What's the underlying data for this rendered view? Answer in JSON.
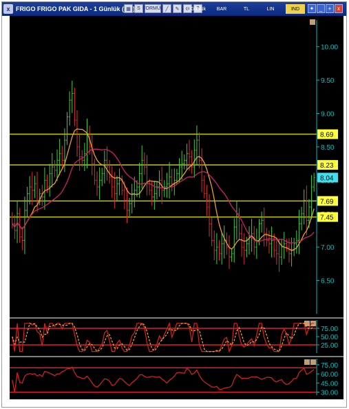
{
  "window": {
    "title": "FRIGO FRIGO PAK GIDA - 1 Günlük (.1d)",
    "close_glyph": "x",
    "toolbar": {
      "period_label": "1 Günlük",
      "chart_type_label": "BAR",
      "currency_label": "TL",
      "scale_label": "LIN",
      "indicator_label": "IND",
      "formula_label": "FORMÜL"
    },
    "controls": [
      "_",
      "+",
      "x"
    ]
  },
  "chart_data": {
    "type": "candlestick",
    "price_axis_ticks": [
      "10.00",
      "9.50",
      "9.00",
      "8.50",
      "8.00",
      "7.50",
      "7.00",
      "6.50"
    ],
    "ylim": [
      6.0,
      10.4
    ],
    "horizontal_levels": [
      {
        "value": 8.69,
        "label": "8.69"
      },
      {
        "value": 8.23,
        "label": "8.23"
      },
      {
        "value": 7.69,
        "label": "7.69"
      },
      {
        "value": 7.45,
        "label": "7.45"
      }
    ],
    "last_price": {
      "value": 8.04,
      "label": "8.04"
    },
    "close_series": [
      7.35,
      7.25,
      7.5,
      7.15,
      7.1,
      7.55,
      7.8,
      7.9,
      7.85,
      7.95,
      7.7,
      7.8,
      7.75,
      8.0,
      7.9,
      8.1,
      8.2,
      8.15,
      8.3,
      8.4,
      8.3,
      8.6,
      8.95,
      9.2,
      9.3,
      8.9,
      8.5,
      8.35,
      8.3,
      8.4,
      8.7,
      8.5,
      8.25,
      8.0,
      7.9,
      8.0,
      8.1,
      8.3,
      8.2,
      8.05,
      7.9,
      7.8,
      7.95,
      8.0,
      7.85,
      7.7,
      7.55,
      7.65,
      7.8,
      7.85,
      7.9,
      8.1,
      8.3,
      8.2,
      7.95,
      7.85,
      7.75,
      7.8,
      7.9,
      8.0,
      7.85,
      7.9,
      7.95,
      8.05,
      7.95,
      8.0,
      8.1,
      8.2,
      8.25,
      8.3,
      8.4,
      8.35,
      8.2,
      8.45,
      8.6,
      8.3,
      8.0,
      7.8,
      7.6,
      7.35,
      7.1,
      6.95,
      7.0,
      6.9,
      7.05,
      7.1,
      7.0,
      6.85,
      6.9,
      7.3,
      7.5,
      7.2,
      7.0,
      6.95,
      7.05,
      7.15,
      7.2,
      7.0,
      7.1,
      7.35,
      7.4,
      7.2,
      7.1,
      7.05,
      7.1,
      6.95,
      6.9,
      6.85,
      7.0,
      7.05,
      7.0,
      6.9,
      6.95,
      7.05,
      7.1,
      7.35,
      7.5,
      7.7,
      7.4,
      7.6,
      7.9,
      8.04
    ],
    "ma_fast_color": "#f0a028",
    "ma_slow_color": "#d0206a",
    "oscillator1": {
      "ticks": [
        "75.00",
        "50.00",
        "25.00"
      ],
      "range": [
        0,
        100
      ],
      "upper_line": 75,
      "lower_line": 25,
      "line_color": "#e02020",
      "signal_color": "#f0b020"
    },
    "oscillator2": {
      "ticks": [
        "75.00",
        "60.00",
        "45.00",
        "30.00"
      ],
      "range": [
        25,
        85
      ],
      "upper_line": 70,
      "lower_line": 30,
      "line_color": "#e02020"
    }
  },
  "colors": {
    "background": "#000000",
    "axis": "#00c0c0",
    "level_line": "#c8c800",
    "level_label_bg": "#ffff40",
    "last_price_bg": "#40e0f0",
    "up_candle": "#40d040",
    "down_candle": "#e03030"
  }
}
